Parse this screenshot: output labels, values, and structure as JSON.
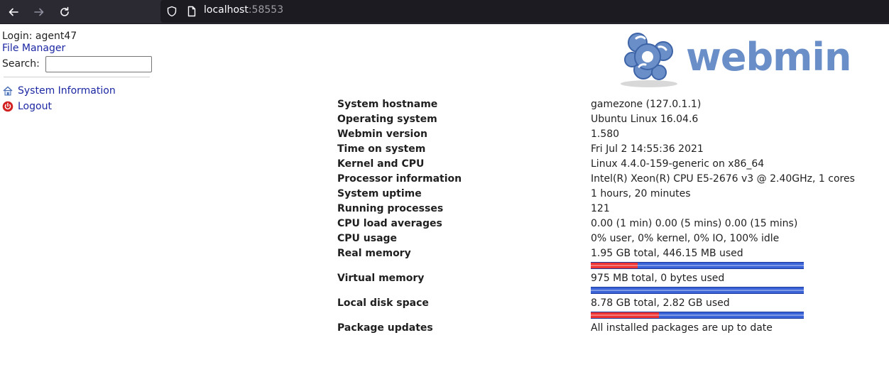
{
  "browser": {
    "url_host": "localhost",
    "url_port": ":58553"
  },
  "sidebar": {
    "login_text": "Login: agent47",
    "file_manager": "File Manager",
    "search_label": "Search:",
    "search_value": "",
    "menu": [
      {
        "label": "System Information",
        "icon": "house-icon"
      },
      {
        "label": "Logout",
        "icon": "power-icon"
      }
    ]
  },
  "logo": {
    "text": "webmin",
    "color": "#6a8fc8"
  },
  "system_info": {
    "hostname": {
      "label": "System hostname",
      "value": "gamezone (127.0.1.1)"
    },
    "os": {
      "label": "Operating system",
      "value": "Ubuntu Linux 16.04.6"
    },
    "webmin_version": {
      "label": "Webmin version",
      "value": "1.580"
    },
    "time": {
      "label": "Time on system",
      "value": "Fri Jul 2 14:55:36 2021"
    },
    "kernel": {
      "label": "Kernel and CPU",
      "value": "Linux 4.4.0-159-generic on x86_64"
    },
    "processor": {
      "label": "Processor information",
      "value": "Intel(R) Xeon(R) CPU E5-2676 v3 @ 2.40GHz, 1 cores"
    },
    "uptime": {
      "label": "System uptime",
      "value": "1 hours, 20 minutes"
    },
    "processes": {
      "label": "Running processes",
      "value": "121"
    },
    "load": {
      "label": "CPU load averages",
      "value": "0.00 (1 min) 0.00 (5 mins) 0.00 (15 mins)"
    },
    "cpu_usage": {
      "label": "CPU usage",
      "value": "0% user, 0% kernel, 0% IO, 100% idle"
    },
    "real_memory": {
      "label": "Real memory",
      "value": "1.95 GB total, 446.15 MB used",
      "used_fraction": 0.22
    },
    "virtual_memory": {
      "label": "Virtual memory",
      "value": "975 MB total, 0 bytes used",
      "used_fraction": 0.0
    },
    "disk": {
      "label": "Local disk space",
      "value": "8.78 GB total, 2.82 GB used",
      "used_fraction": 0.32
    },
    "packages": {
      "label": "Package updates",
      "value": "All installed packages are up to date"
    }
  },
  "colors": {
    "bar_used": "#ee3333",
    "bar_free": "#3b63d8",
    "link": "#1c27a3"
  }
}
